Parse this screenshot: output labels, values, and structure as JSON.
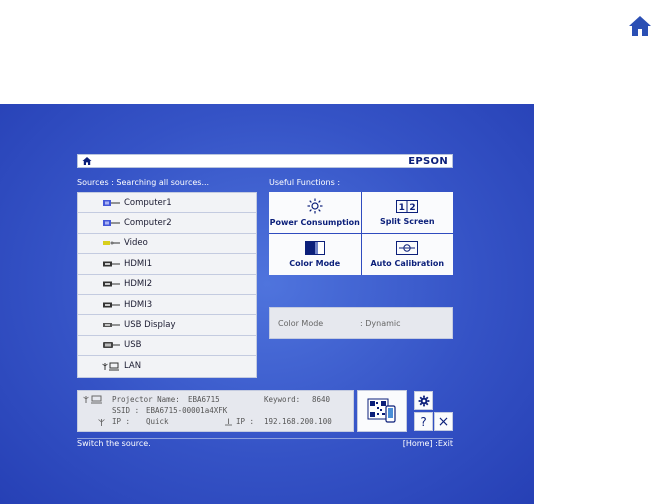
{
  "header": {
    "brand": "EPSON"
  },
  "sources": {
    "label": "Sources :  Searching all sources...",
    "items": [
      {
        "label": "Computer1",
        "icon": "vga-plug-icon"
      },
      {
        "label": "Computer2",
        "icon": "vga-plug-icon"
      },
      {
        "label": "Video",
        "icon": "rca-plug-icon"
      },
      {
        "label": "HDMI1",
        "icon": "hdmi-plug-icon"
      },
      {
        "label": "HDMI2",
        "icon": "hdmi-plug-icon"
      },
      {
        "label": "HDMI3",
        "icon": "hdmi-plug-icon"
      },
      {
        "label": "USB Display",
        "icon": "usb-plug-icon"
      },
      {
        "label": "USB",
        "icon": "usb-b-plug-icon"
      },
      {
        "label": "LAN",
        "icon": "lan-icon"
      }
    ]
  },
  "functions": {
    "label": "Useful Functions :",
    "items": [
      {
        "label": "Power Consumption",
        "icon": "sun-icon"
      },
      {
        "label": "Split Screen",
        "icon": "split-screen-icon"
      },
      {
        "label": "Color Mode",
        "icon": "color-mode-icon"
      },
      {
        "label": "Auto Calibration",
        "icon": "calibration-icon"
      }
    ]
  },
  "color_mode": {
    "label": "Color Mode",
    "value": ": Dynamic"
  },
  "network": {
    "projector_name_label": "Projector Name:",
    "projector_name": "EBA6715",
    "keyword_label": "Keyword:",
    "keyword": "8640",
    "ssid_label": "SSID :",
    "ssid": "EBA6715-00001a4XFK",
    "ip_mode_label": "IP :",
    "ip_mode": "Quick",
    "ip_label": "IP :",
    "ip": "192.168.200.100"
  },
  "buttons": {
    "help": "?",
    "close": "×"
  },
  "footer": {
    "hint": "Switch the source.",
    "exit": "[Home] :Exit"
  },
  "colors": {
    "background": "#3553c6",
    "accent": "#0b1f7a",
    "panel": "#f2f3f6"
  }
}
